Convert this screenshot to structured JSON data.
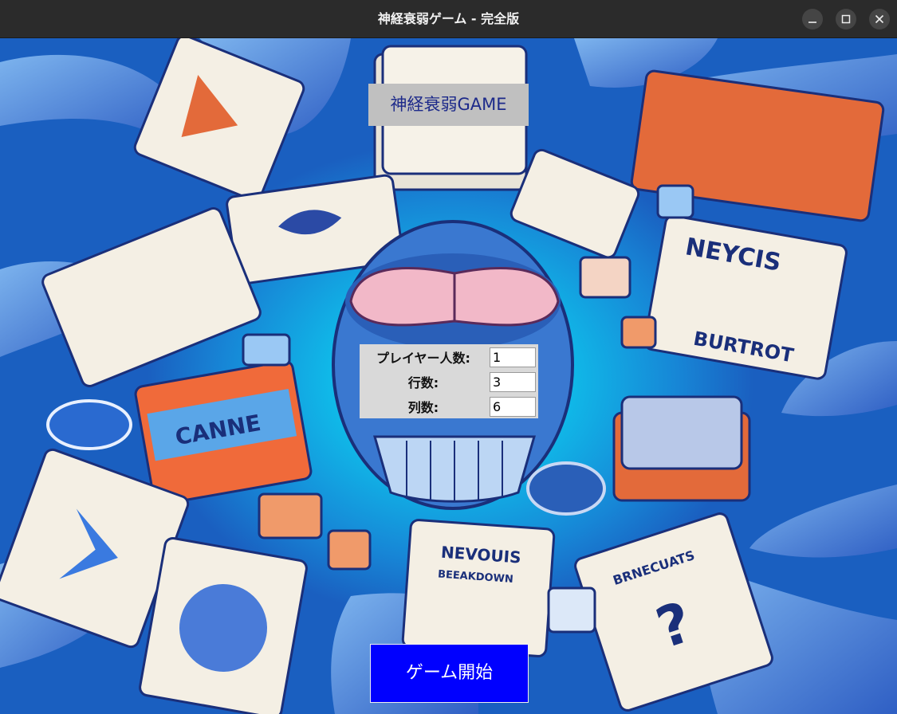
{
  "window": {
    "title": "神経衰弱ゲーム - 完全版",
    "controls": [
      "minimize-icon",
      "maximize-icon",
      "close-icon"
    ]
  },
  "game": {
    "title": "神経衰弱GAME",
    "settings": [
      {
        "label": "プレイヤー人数:",
        "value": "1"
      },
      {
        "label": "行数:",
        "value": "3"
      },
      {
        "label": "列数:",
        "value": "6"
      }
    ],
    "start_label": "ゲーム開始"
  },
  "background_art": {
    "card_texts": [
      "NEVOUIS BEEAKDOWN",
      "NEYCIS BURTROT",
      "CANNE",
      "BRNECUATS"
    ]
  },
  "colors": {
    "background_center": "#10e0f0",
    "background_edge": "#1a5fc0",
    "title_bg": "#c0c0c0",
    "title_text": "#1d2a8a",
    "start_button": "#0000ff"
  }
}
